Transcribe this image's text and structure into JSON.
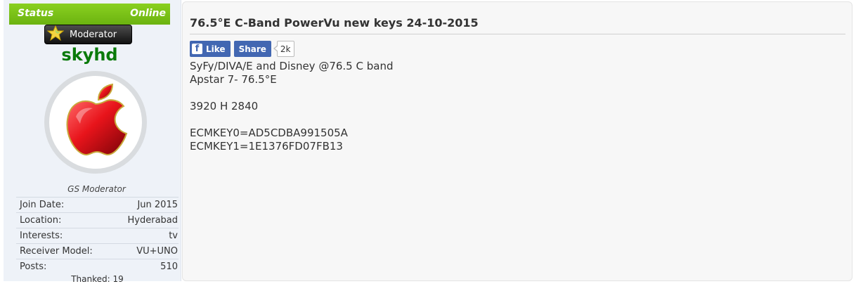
{
  "sidebar": {
    "status_label": "Status",
    "status_value": "Online",
    "rank": "Moderator",
    "username": "skyhd",
    "user_title": "GS Moderator",
    "info": [
      {
        "label": "Join Date:",
        "value": "Jun 2015"
      },
      {
        "label": "Location:",
        "value": "Hyderabad"
      },
      {
        "label": "Interests:",
        "value": "tv"
      },
      {
        "label": "Receiver Model:",
        "value": "VU+UNO"
      },
      {
        "label": "Posts:",
        "value": "510"
      }
    ],
    "thanked": "Thanked: 19"
  },
  "post": {
    "title": "76.5°E C-Band PowerVu new keys 24-10-2015",
    "like_label": "Like",
    "share_label": "Share",
    "share_count": "2k",
    "lines": [
      "SyFy/DIVA/E and Disney @76.5 C band",
      "Apstar 7- 76.5°E",
      "",
      "3920 H 2840",
      "",
      "ECMKEY0=AD5CDBA991505A",
      "ECMKEY1=1E1376FD07FB13"
    ]
  },
  "colors": {
    "status_green": "#7cc31a",
    "username_green": "#0a7a0a",
    "facebook_blue": "#4267b2"
  },
  "icons": {
    "rank": "star-icon",
    "facebook": "facebook-icon",
    "avatar": "apple-logo-avatar"
  }
}
